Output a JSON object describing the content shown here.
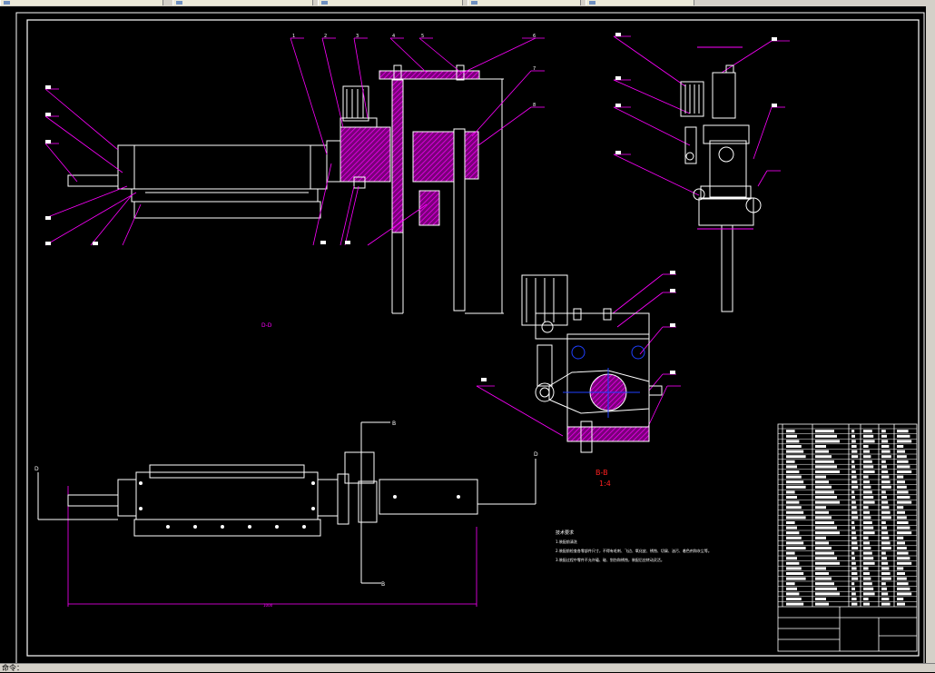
{
  "window": {
    "tabs": [
      {
        "label": "",
        "name": "tab-1"
      },
      {
        "label": "",
        "name": "tab-2"
      },
      {
        "label": "",
        "name": "tab-3"
      },
      {
        "label": "",
        "name": "tab-4"
      },
      {
        "label": "",
        "name": "tab-5"
      }
    ]
  },
  "drawing": {
    "view_label_dd": "D-D",
    "section_label": "B-B",
    "section_scale": "1:4",
    "section_mark_b_top": "B",
    "section_mark_b_bottom": "B",
    "section_mark_d_left": "D",
    "section_mark_d_right": "D",
    "tech_req_title": "技术要求",
    "tech_req_lines": [
      "1.装配前清洗",
      "2.装配前检查各零部件尺寸，不得有毛刺、飞边、氧化皮、锈蚀、切屑、油污、着色剂和灰尘等。",
      "3.装配过程中零件不允许磕、碰、划伤和锈蚀，装配后应转动灵活。"
    ],
    "part_numbers_top": [
      "1",
      "2",
      "3",
      "4",
      "5",
      "6",
      "7",
      "8"
    ],
    "dimension_overall": "1000"
  },
  "status": {
    "text": "命令："
  },
  "colors": {
    "background": "#000000",
    "geometry": "#ffffff",
    "leader": "#ff00ff",
    "hatch": "#ff00ff",
    "section_label": "#ff2020",
    "centerline": "#2040ff"
  }
}
